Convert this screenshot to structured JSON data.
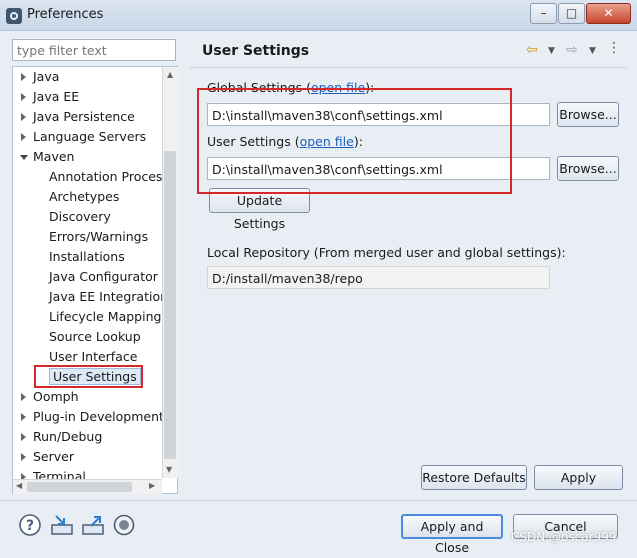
{
  "window": {
    "title": "Preferences",
    "minimize": "–",
    "maximize": "□",
    "close": "✕"
  },
  "filter": {
    "placeholder": "type filter text"
  },
  "tree": {
    "items": [
      {
        "label": "Java",
        "state": "collapsed"
      },
      {
        "label": "Java EE",
        "state": "collapsed"
      },
      {
        "label": "Java Persistence",
        "state": "collapsed"
      },
      {
        "label": "Language Servers",
        "state": "collapsed"
      },
      {
        "label": "Maven",
        "state": "expanded"
      },
      {
        "label": "Annotation Process",
        "state": "leaf"
      },
      {
        "label": "Archetypes",
        "state": "leaf"
      },
      {
        "label": "Discovery",
        "state": "leaf"
      },
      {
        "label": "Errors/Warnings",
        "state": "leaf"
      },
      {
        "label": "Installations",
        "state": "leaf"
      },
      {
        "label": "Java Configurator",
        "state": "leaf"
      },
      {
        "label": "Java EE Integration",
        "state": "leaf"
      },
      {
        "label": "Lifecycle Mappings",
        "state": "leaf"
      },
      {
        "label": "Source Lookup",
        "state": "leaf"
      },
      {
        "label": "User Interface",
        "state": "leaf"
      },
      {
        "label": "User Settings",
        "state": "selected"
      },
      {
        "label": "Oomph",
        "state": "collapsed"
      },
      {
        "label": "Plug-in Development",
        "state": "collapsed"
      },
      {
        "label": "Run/Debug",
        "state": "collapsed"
      },
      {
        "label": "Server",
        "state": "collapsed"
      },
      {
        "label": "Terminal",
        "state": "collapsed"
      }
    ]
  },
  "page": {
    "title": "User Settings",
    "global_settings": {
      "label_pre": "Global Settings (",
      "link": "open file",
      "label_post": "):",
      "value": "D:\\install\\maven38\\conf\\settings.xml",
      "browse": "Browse..."
    },
    "user_settings": {
      "label_pre": "User Settings (",
      "link": "open file",
      "label_post": "):",
      "value": "D:\\install\\maven38\\conf\\settings.xml",
      "browse": "Browse..."
    },
    "update_button": "Update Settings",
    "local_repo": {
      "label": "Local Repository (From merged user and global settings):",
      "value": "D:/install/maven38/repo"
    },
    "restore_defaults": "Restore Defaults",
    "apply": "Apply"
  },
  "footer": {
    "apply_and_close": "Apply and Close",
    "cancel": "Cancel",
    "icons": [
      "help-icon",
      "import-icon",
      "export-icon",
      "record-icon"
    ]
  },
  "watermark": "CSDN @oscar999"
}
